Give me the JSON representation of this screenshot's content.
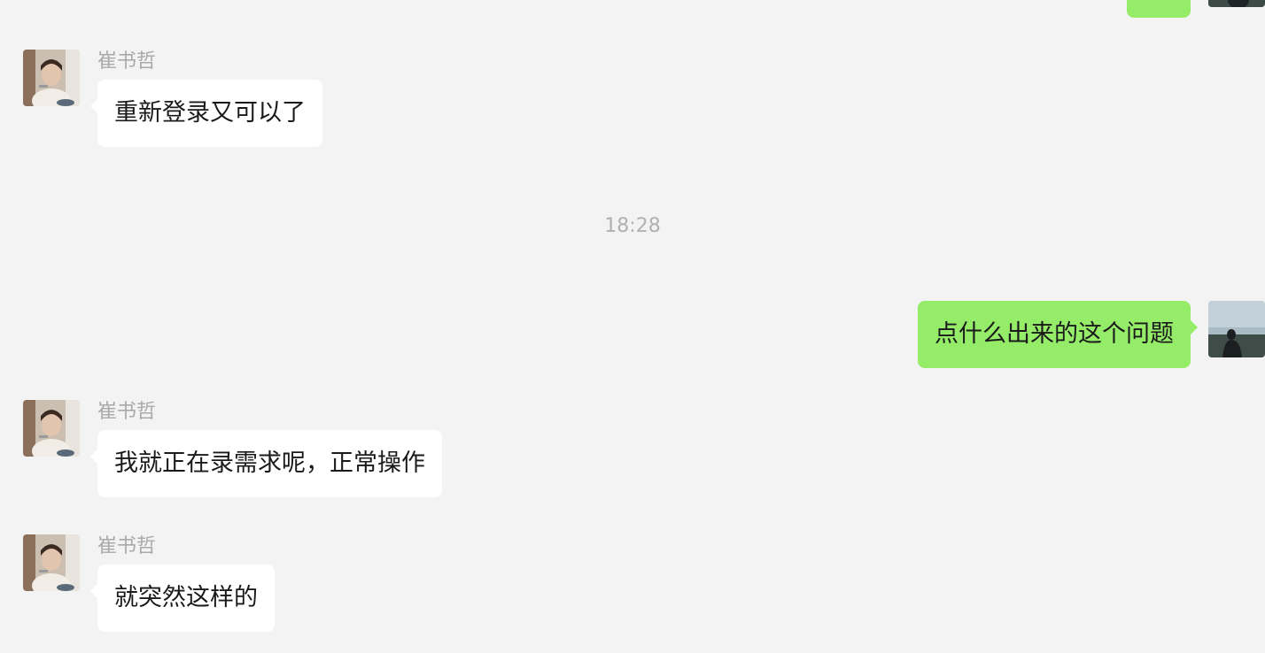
{
  "messages": [
    {
      "sender": "崔书哲",
      "text": "重新登录又可以了"
    },
    {
      "sender": "崔书哲",
      "text": "我就正在录需求呢，正常操作"
    },
    {
      "sender": "崔书哲",
      "text": "就突然这样的"
    }
  ],
  "my_messages": [
    {
      "text": "点什么出来的这个问题"
    }
  ],
  "timestamp": "18:28",
  "colors": {
    "background": "#f3f3f3",
    "incoming_bubble": "#ffffff",
    "outgoing_bubble": "#95ec69",
    "sender_name": "#a9a9a9"
  }
}
